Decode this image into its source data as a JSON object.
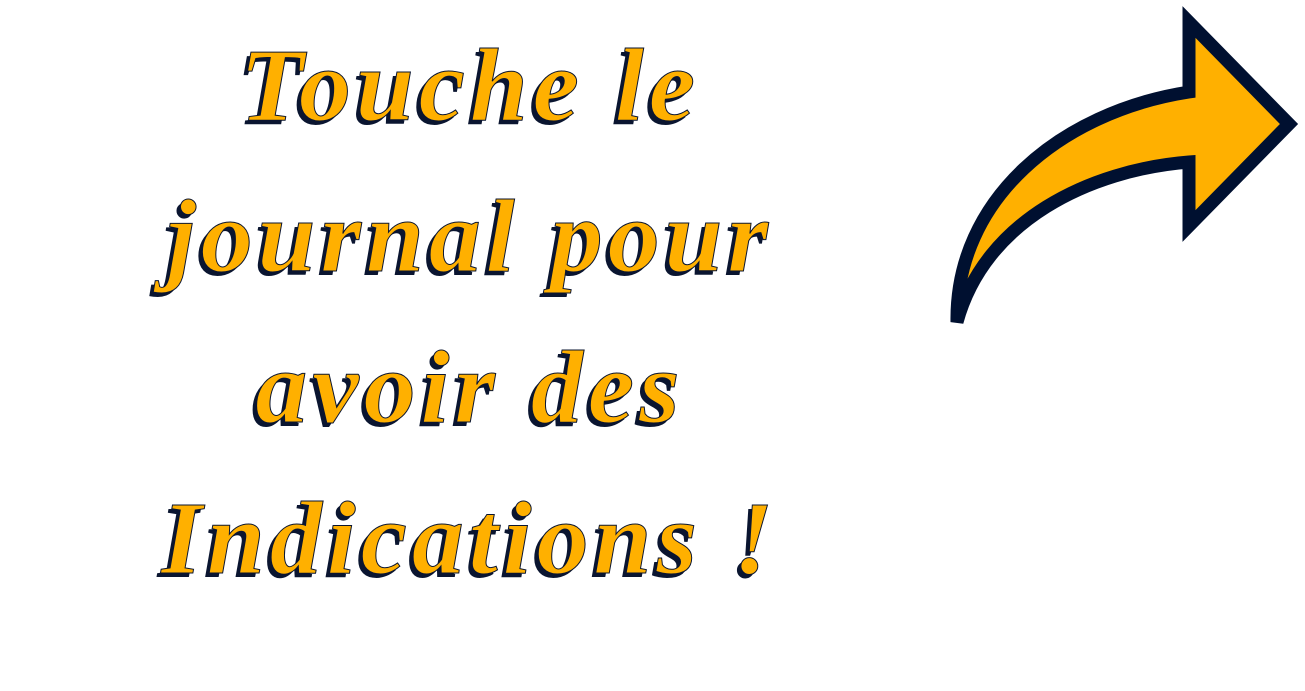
{
  "message": {
    "lines": [
      "Touche le",
      "journal pour",
      "avoir des",
      "Indications !"
    ]
  },
  "arrow": {
    "icon": "curved-arrow-right-icon",
    "fill": "#FFB000",
    "outline": "#001030"
  },
  "colors": {
    "text": "#FFB000",
    "shadow": "#0a1530",
    "background": "#ffffff"
  }
}
